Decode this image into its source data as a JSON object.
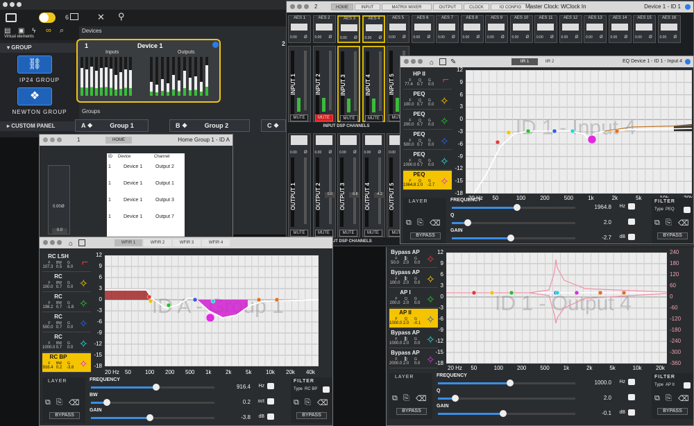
{
  "main": {
    "virtual_label": "Virtual elements",
    "devices_label": "Devices",
    "groups_label": "Groups",
    "group_header": "GROUP",
    "ip24_label": "IP24 GROUP",
    "newton_label": "NEWTON GROUP",
    "custom_panel": "CUSTOM PANEL",
    "toolbar_count": "6",
    "device": {
      "num": "1",
      "name": "Device 1",
      "inputs": "Inputs",
      "outputs": "Outputs"
    },
    "next_device_num": "2",
    "groups": [
      {
        "letter": "A",
        "name": "Group 1"
      },
      {
        "letter": "B",
        "name": "Group 2"
      },
      {
        "letter": "C",
        "name": ""
      }
    ]
  },
  "dsp": {
    "num": "2",
    "tabs": [
      "HOME",
      "INPUT",
      "MATRIX MIXER",
      "OUTPUT",
      "CLOCK",
      "IO CONFIG"
    ],
    "clock": "Master Clock: WClock In",
    "device": "Device 1 - ID 1",
    "aes": [
      "AES 1",
      "AES 2",
      "AES 3",
      "AES 4",
      "AES 5",
      "AES 6",
      "AES 7",
      "AES 8",
      "AES 9",
      "AES 10",
      "AES 11",
      "AES 12",
      "AES 13",
      "AES 14",
      "AES 15",
      "AES 16"
    ],
    "inputs": [
      {
        "name": "INPUT 1",
        "mute": "MUTE",
        "muted": false,
        "val": "0.00"
      },
      {
        "name": "INPUT 2",
        "mute": "MUTE",
        "muted": true,
        "val": "0.00"
      },
      {
        "name": "INPUT 3",
        "mute": "MUTE",
        "muted": false,
        "val": "0.00"
      },
      {
        "name": "INPUT 4",
        "mute": "MUTE",
        "muted": false,
        "val": "0.00"
      },
      {
        "name": "INPUT 5",
        "mute": "MUTE",
        "muted": false,
        "val": "0.00"
      }
    ],
    "outputs": [
      {
        "name": "OUTPUT 1",
        "val": "0.00"
      },
      {
        "name": "OUTPUT 2",
        "val": "0.00",
        "fader": "0.0"
      },
      {
        "name": "OUTPUT 3",
        "val": "0.00",
        "fader": "-9.8"
      },
      {
        "name": "OUTPUT 4",
        "val": "0.00",
        "fader": "-4.2"
      },
      {
        "name": "OUTPUT 5",
        "val": "0.00"
      }
    ],
    "input_section": "INPUT DSP CHANNELS",
    "output_section": "OUTPUT DSP CHANNELS",
    "phase": "Ø",
    "fader_scale": [
      "-6",
      "-12",
      "-18",
      "-24",
      "-30",
      "-36",
      "-42",
      "-48",
      "-54",
      "-60"
    ]
  },
  "home_group": {
    "num": "1",
    "tab": "HOME",
    "title": "Home Group 1 - ID A",
    "cols": [
      "ID",
      "Device",
      "Channel"
    ],
    "rows": [
      [
        "1",
        "Device 1",
        "Output 2"
      ],
      [
        "1",
        "Device 1",
        "Output 1"
      ],
      [
        "1",
        "Device 1",
        "Output 3"
      ],
      [
        "1",
        "Device 1",
        "Output 7"
      ]
    ],
    "fader_val": "0.0",
    "val": "0.00",
    "phase": "Ø"
  },
  "eq_input": {
    "tabs": [
      "IIR 1",
      "IIR 2"
    ],
    "title": "EQ Device 1 - ID 1 - Input 4",
    "watermark": "ID 1 - Input 4",
    "bands": [
      {
        "name": "HP II",
        "F": "77.4",
        "Q": "0.7",
        "G": "0.0",
        "color": "#e03a3a"
      },
      {
        "name": "PEQ",
        "F": "100.0",
        "Q": "0.7",
        "G": "0.0",
        "color": "#f2c200"
      },
      {
        "name": "PEQ",
        "F": "200.0",
        "Q": "0.7",
        "G": "0.0",
        "color": "#28c028"
      },
      {
        "name": "PEQ",
        "F": "500.0",
        "Q": "0.7",
        "G": "0.0",
        "color": "#2a60e0"
      },
      {
        "name": "PEQ",
        "F": "1000.0",
        "Q": "0.7",
        "G": "0.0",
        "color": "#20d8d8"
      },
      {
        "name": "PEQ",
        "F": "1964.8",
        "Q": "2.0",
        "G": "-2.7",
        "color": "#e02ae0",
        "selected": true
      }
    ],
    "y_ticks": [
      "12",
      "9",
      "6",
      "3",
      "0",
      "-3",
      "-6",
      "-9",
      "-12",
      "-15",
      "-18"
    ],
    "x_ticks": [
      "20 Hz",
      "50",
      "100",
      "200",
      "500",
      "1k",
      "2k",
      "5k",
      "10k",
      "20k"
    ],
    "layer": "LAYER",
    "filter": "FILTER",
    "type_label": "Type",
    "type": "PEQ",
    "bypass": "BYPASS",
    "params": [
      {
        "name": "FREQUENCY",
        "value": "1964.8",
        "unit": "Hz"
      },
      {
        "name": "Q",
        "value": "2.0",
        "unit": ""
      },
      {
        "name": "GAIN",
        "value": "-2.7",
        "unit": "dB"
      }
    ]
  },
  "eq_group": {
    "tabs": [
      "WFIR 1",
      "WFIR 2",
      "WFIR 3",
      "WFIR 4"
    ],
    "watermark": "ID A - Group 1",
    "bands": [
      {
        "name": "RC LSH",
        "F": "107.3",
        "Q": "0.5",
        "G": "6.0",
        "color": "#e03a3a"
      },
      {
        "name": "RC",
        "F": "100.0",
        "Q": "0.7",
        "G": "0.0",
        "color": "#f2c200"
      },
      {
        "name": "RC",
        "F": "198.2",
        "Q": "0.7",
        "G": "-1.8",
        "color": "#28c028"
      },
      {
        "name": "RC",
        "F": "500.0",
        "Q": "0.7",
        "G": "0.0",
        "color": "#2a60e0"
      },
      {
        "name": "RC",
        "F": "1000.0",
        "Q": "0.7",
        "G": "0.0",
        "color": "#20d8d8"
      },
      {
        "name": "RC BP",
        "F": "916.4",
        "Q": "0.2",
        "G": "-3.8",
        "color": "#e02ae0",
        "selected": true
      }
    ],
    "y_ticks": [
      "12",
      "9",
      "6",
      "3",
      "0",
      "-3",
      "-6",
      "-9",
      "-12",
      "-15",
      "-18"
    ],
    "x_ticks": [
      "20 Hz",
      "50",
      "100",
      "200",
      "500",
      "1k",
      "2k",
      "5k",
      "10k",
      "20k",
      "40k"
    ],
    "layer": "LAYER",
    "filter": "FILTER",
    "type_label": "Type",
    "type": "RC BP",
    "bypass": "BYPASS",
    "params": [
      {
        "name": "FREQUENCY",
        "value": "916.4",
        "unit": "Hz"
      },
      {
        "name": "BW",
        "value": "0.2",
        "unit": "oct"
      },
      {
        "name": "GAIN",
        "value": "-3.8",
        "unit": "dB"
      }
    ]
  },
  "eq_output": {
    "watermark": "ID 1 - Output 4",
    "bands": [
      {
        "name": "Bypass AP I",
        "F": "50.0",
        "Q": "2.0",
        "G": "0.0",
        "color": "#e03a3a"
      },
      {
        "name": "Bypass AP I",
        "F": "100.0",
        "Q": "2.0",
        "G": "0.0",
        "color": "#f2c200"
      },
      {
        "name": "AP I",
        "F": "200.0",
        "Q": "2.0",
        "G": "0.0",
        "color": "#28c028"
      },
      {
        "name": "AP II",
        "F": "1000.0",
        "Q": "2.0",
        "G": "-0.1",
        "color": "#2a60e0",
        "selected": true
      },
      {
        "name": "Bypass AP I",
        "F": "1000.0",
        "Q": "2.0",
        "G": "0.0",
        "color": "#20d8d8"
      },
      {
        "name": "Bypass AP I",
        "F": "2000.0",
        "Q": "2.0",
        "G": "0.0",
        "color": "#e02ae0"
      }
    ],
    "y_ticks": [
      "12",
      "9",
      "6",
      "3",
      "0",
      "-3",
      "-6",
      "-9",
      "-12",
      "-15",
      "-18"
    ],
    "y2_ticks": [
      "240",
      "180",
      "120",
      "60",
      "0",
      "-60",
      "-120",
      "-180",
      "-240",
      "-300",
      "-360"
    ],
    "x_ticks": [
      "20 Hz",
      "50",
      "100",
      "200",
      "500",
      "1k",
      "2k",
      "5k",
      "10k",
      "20k"
    ],
    "layer": "LAYER",
    "filter": "FILTER",
    "type_label": "Type",
    "type": "AP II",
    "bypass": "BYPASS",
    "params": [
      {
        "name": "FREQUENCY",
        "value": "1000.0",
        "unit": "Hz"
      },
      {
        "name": "Q",
        "value": "2.0",
        "unit": ""
      },
      {
        "name": "GAIN",
        "value": "-0.1",
        "unit": "dB"
      }
    ]
  },
  "band_letters": [
    "F",
    "Q",
    "G"
  ],
  "band_letters_bw": [
    "F",
    "BW",
    "G"
  ]
}
